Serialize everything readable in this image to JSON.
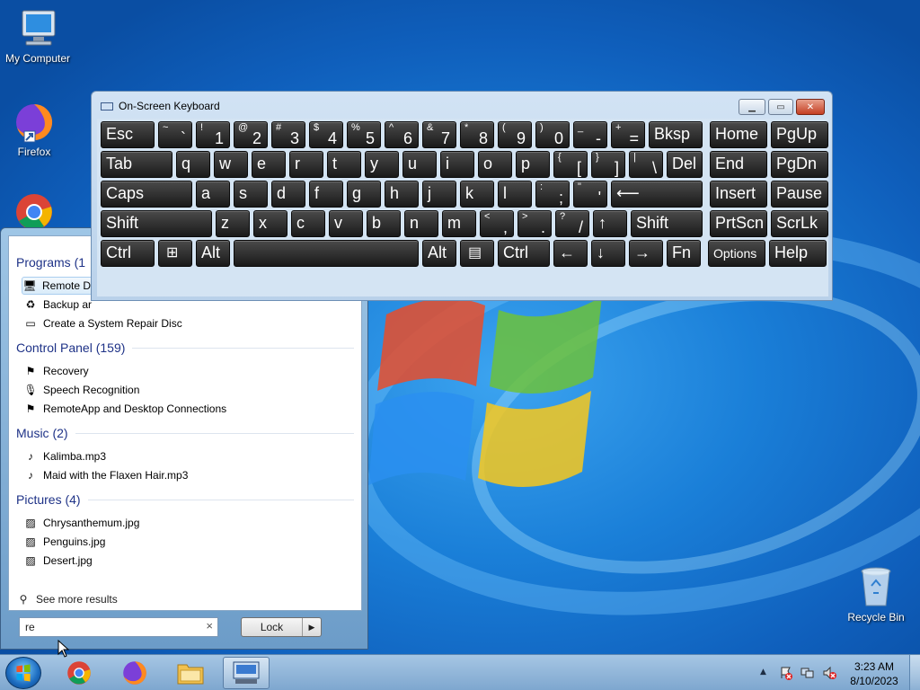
{
  "desktop": {
    "icons": [
      {
        "label": "My Computer",
        "icon": "computer-icon"
      },
      {
        "label": "Firefox",
        "icon": "firefox-icon"
      },
      {
        "label": "Recycle Bin",
        "icon": "recycle-bin-icon"
      }
    ]
  },
  "osk": {
    "title": "On-Screen Keyboard",
    "rows": [
      [
        {
          "l": "Esc"
        },
        {
          "l": "`",
          "s": "~"
        },
        {
          "l": "1",
          "s": "!"
        },
        {
          "l": "2",
          "s": "@"
        },
        {
          "l": "3",
          "s": "#"
        },
        {
          "l": "4",
          "s": "$"
        },
        {
          "l": "5",
          "s": "%"
        },
        {
          "l": "6",
          "s": "^"
        },
        {
          "l": "7",
          "s": "&"
        },
        {
          "l": "8",
          "s": "*"
        },
        {
          "l": "9",
          "s": "("
        },
        {
          "l": "0",
          "s": ")"
        },
        {
          "l": "-",
          "s": "_"
        },
        {
          "l": "=",
          "s": "+"
        },
        {
          "l": "Bksp"
        },
        {
          "l": "Home"
        },
        {
          "l": "PgUp"
        }
      ],
      [
        {
          "l": "Tab"
        },
        {
          "l": "q"
        },
        {
          "l": "w"
        },
        {
          "l": "e"
        },
        {
          "l": "r"
        },
        {
          "l": "t"
        },
        {
          "l": "y"
        },
        {
          "l": "u"
        },
        {
          "l": "i"
        },
        {
          "l": "o"
        },
        {
          "l": "p"
        },
        {
          "l": "[",
          "s": "{"
        },
        {
          "l": "]",
          "s": "}"
        },
        {
          "l": "\\",
          "s": "|"
        },
        {
          "l": "Del"
        },
        {
          "l": "End"
        },
        {
          "l": "PgDn"
        }
      ],
      [
        {
          "l": "Caps"
        },
        {
          "l": "a"
        },
        {
          "l": "s"
        },
        {
          "l": "d"
        },
        {
          "l": "f"
        },
        {
          "l": "g"
        },
        {
          "l": "h"
        },
        {
          "l": "j"
        },
        {
          "l": "k"
        },
        {
          "l": "l"
        },
        {
          "l": ";",
          "s": ":"
        },
        {
          "l": "'",
          "s": "\""
        },
        {
          "l": "⟵"
        },
        {
          "l": "Insert"
        },
        {
          "l": "Pause"
        }
      ],
      [
        {
          "l": "Shift"
        },
        {
          "l": "z"
        },
        {
          "l": "x"
        },
        {
          "l": "c"
        },
        {
          "l": "v"
        },
        {
          "l": "b"
        },
        {
          "l": "n"
        },
        {
          "l": "m"
        },
        {
          "l": ",",
          "s": "<"
        },
        {
          "l": ".",
          "s": ">"
        },
        {
          "l": "/",
          "s": "?"
        },
        {
          "l": "↑"
        },
        {
          "l": "Shift"
        },
        {
          "l": "PrtScn"
        },
        {
          "l": "ScrLk"
        }
      ],
      [
        {
          "l": "Ctrl"
        },
        {
          "l": "",
          "icon": "windows-logo-icon"
        },
        {
          "l": "Alt"
        },
        {
          "l": ""
        },
        {
          "l": "Alt"
        },
        {
          "l": "",
          "icon": "menu-icon"
        },
        {
          "l": "Ctrl"
        },
        {
          "l": "←"
        },
        {
          "l": "↓"
        },
        {
          "l": "→"
        },
        {
          "l": "Fn"
        },
        {
          "l": "Options"
        },
        {
          "l": "Help"
        }
      ]
    ]
  },
  "start_menu": {
    "groups": [
      {
        "title": "Programs (1",
        "items": [
          {
            "label": "Remote D",
            "icon": "remote-desktop-icon",
            "selected": true
          },
          {
            "label": "Backup ar",
            "icon": "backup-icon"
          },
          {
            "label": "Create a System Repair Disc",
            "icon": "repair-disc-icon"
          }
        ]
      },
      {
        "title": "Control Panel (159)",
        "items": [
          {
            "label": "Recovery",
            "icon": "recovery-icon"
          },
          {
            "label": "Speech Recognition",
            "icon": "microphone-icon"
          },
          {
            "label": "RemoteApp and Desktop Connections",
            "icon": "remoteapp-icon"
          }
        ]
      },
      {
        "title": "Music (2)",
        "items": [
          {
            "label": "Kalimba.mp3",
            "icon": "music-file-icon"
          },
          {
            "label": "Maid with the Flaxen Hair.mp3",
            "icon": "music-file-icon"
          }
        ]
      },
      {
        "title": "Pictures (4)",
        "items": [
          {
            "label": "Chrysanthemum.jpg",
            "icon": "image-file-icon"
          },
          {
            "label": "Penguins.jpg",
            "icon": "image-file-icon"
          },
          {
            "label": "Desert.jpg",
            "icon": "image-file-icon"
          }
        ]
      }
    ],
    "see_more": "See more results",
    "search_value": "re",
    "search_clear": "×",
    "lock_label": "Lock",
    "lock_arrow": "▶"
  },
  "taskbar": {
    "apps": [
      "chrome-icon",
      "firefox-icon",
      "file-explorer-icon",
      "on-screen-keyboard-icon"
    ],
    "active_app": "on-screen-keyboard-icon",
    "tray_up": "▲",
    "time": "3:23 AM",
    "date": "8/10/2023"
  }
}
